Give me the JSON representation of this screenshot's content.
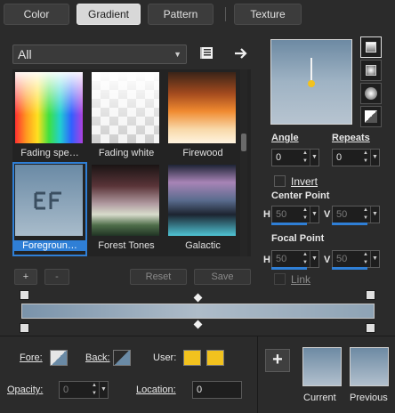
{
  "tabs": [
    {
      "label": "Color",
      "active": false
    },
    {
      "label": "Gradient",
      "active": true
    },
    {
      "label": "Pattern",
      "active": false
    },
    {
      "label": "Texture",
      "active": false
    }
  ],
  "category": {
    "value": "All"
  },
  "presets": [
    {
      "label": "Fading spe…",
      "name": "fading-spectrum"
    },
    {
      "label": "Fading white",
      "name": "fading-white"
    },
    {
      "label": "Firewood",
      "name": "firewood"
    },
    {
      "label": "Foregroun…",
      "name": "foreground-background",
      "selected": true
    },
    {
      "label": "Forest Tones",
      "name": "forest-tones"
    },
    {
      "label": "Galactic",
      "name": "galactic"
    }
  ],
  "preset_buttons": {
    "add": "+",
    "remove": "-",
    "reset": "Reset",
    "save": "Save"
  },
  "angle": {
    "label": "Angle",
    "value": "0"
  },
  "repeats": {
    "label": "Repeats",
    "value": "0"
  },
  "invert": {
    "label": "Invert",
    "checked": false
  },
  "center_point": {
    "label": "Center Point",
    "h_label": "H",
    "h_value": "50",
    "v_label": "V",
    "v_value": "50"
  },
  "focal_point": {
    "label": "Focal Point",
    "h_label": "H",
    "h_value": "50",
    "v_label": "V",
    "v_value": "50"
  },
  "link": {
    "label": "Link",
    "checked": false
  },
  "bottom": {
    "fore_label": "Fore:",
    "back_label": "Back:",
    "user_label": "User:",
    "opacity_label": "Opacity:",
    "opacity_value": "0",
    "location_label": "Location:",
    "location_value": "0",
    "add_button": "+",
    "current_label": "Current",
    "previous_label": "Previous"
  },
  "colors": {
    "accent": "#2f7fd6",
    "user_yellow": "#f2c21e",
    "gradient_start": "#7a93aa",
    "gradient_mid": "#aebcc9",
    "gradient_end": "#8ea3b5"
  },
  "icons": {
    "library": "gradient-library-icon",
    "export": "arrow-right-icon"
  }
}
